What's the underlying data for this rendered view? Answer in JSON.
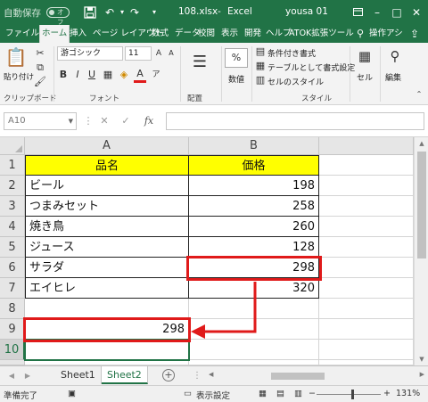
{
  "titlebar": {
    "autosave_label": "自動保存",
    "autosave_state": "オフ",
    "filename": "108.xlsx",
    "separator": "-",
    "app_name": "Excel",
    "user": "yousa 01"
  },
  "ribbon_tabs": [
    "ファイル",
    "ホーム",
    "挿入",
    "ページ レイアウト",
    "数式",
    "データ",
    "校閲",
    "表示",
    "開発",
    "ヘルプ",
    "ATOK拡張ツール",
    "操作アシ"
  ],
  "ribbon": {
    "paste_label": "貼り付け",
    "font_name": "游ゴシック",
    "font_size": "11",
    "bold": "B",
    "italic": "I",
    "underline": "U",
    "font_color_glyph": "A",
    "percent": "%",
    "number_label": "数値",
    "cond_format": "条件付き書式",
    "table_format": "テーブルとして書式設定",
    "cell_style": "セルのスタイル",
    "cell_label": "セル",
    "edit_label": "編集",
    "groups": {
      "clipboard": "クリップボード",
      "font": "フォント",
      "align": "配置",
      "style": "スタイル"
    }
  },
  "formula_bar": {
    "name_box": "A10",
    "fx": "fx",
    "formula": ""
  },
  "grid": {
    "columns": [
      "A",
      "B"
    ],
    "rows": [
      "1",
      "2",
      "3",
      "4",
      "5",
      "6",
      "7",
      "8",
      "9",
      "10"
    ],
    "header_a": "品名",
    "header_b": "価格",
    "items": [
      {
        "name": "ビール",
        "price": "198"
      },
      {
        "name": "つまみセット",
        "price": "258"
      },
      {
        "name": "焼き鳥",
        "price": "260"
      },
      {
        "name": "ジュース",
        "price": "128"
      },
      {
        "name": "サラダ",
        "price": "298"
      },
      {
        "name": "エイヒレ",
        "price": "320"
      }
    ],
    "a9_value": "298"
  },
  "sheets": [
    "Sheet1",
    "Sheet2"
  ],
  "add_sheet": "+",
  "status": {
    "ready": "準備完了",
    "display_settings": "表示設定",
    "zoom": "131%",
    "minus": "−",
    "plus": "+"
  },
  "colors": {
    "excel_green": "#217346",
    "header_fill": "#ffff00",
    "highlight_red": "#e01a1a"
  }
}
